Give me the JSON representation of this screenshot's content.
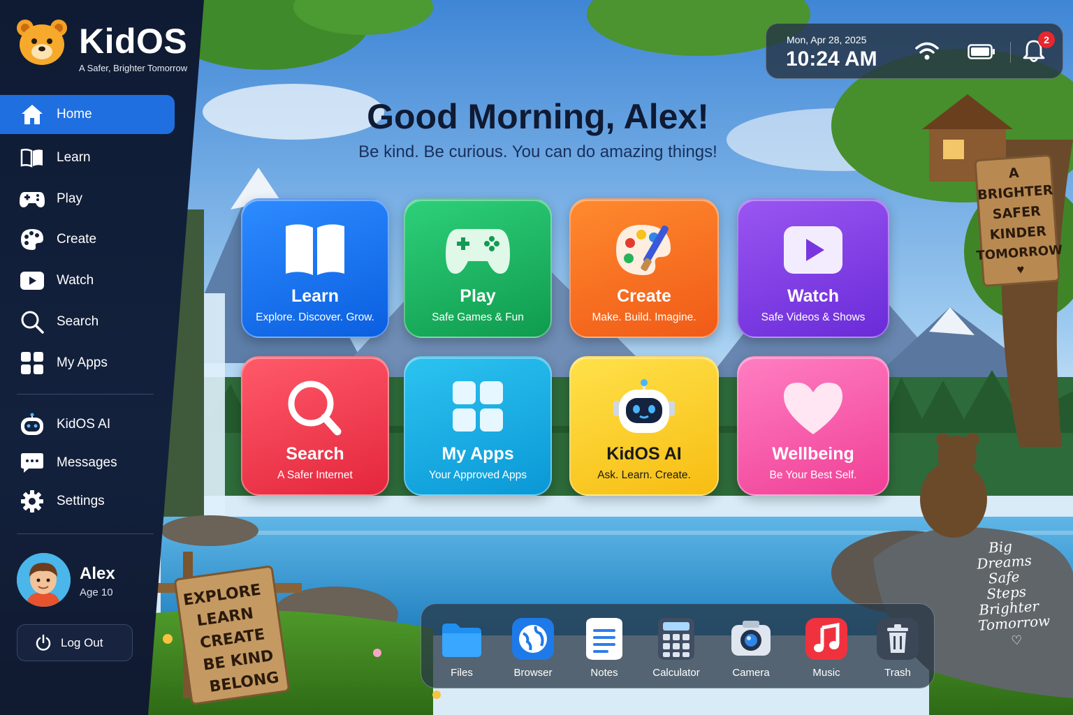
{
  "brand": {
    "name": "KidOS",
    "tagline": "A Safer, Brighter Tomorrow"
  },
  "sidebar": {
    "items": [
      {
        "label": "Home",
        "icon": "home-icon",
        "active": true
      },
      {
        "label": "Learn",
        "icon": "book-icon"
      },
      {
        "label": "Play",
        "icon": "gamepad-icon"
      },
      {
        "label": "Create",
        "icon": "palette-icon"
      },
      {
        "label": "Watch",
        "icon": "play-icon"
      },
      {
        "label": "Search",
        "icon": "search-icon"
      },
      {
        "label": "My Apps",
        "icon": "apps-grid-icon"
      }
    ],
    "secondary": [
      {
        "label": "KidOS AI",
        "icon": "robot-icon"
      },
      {
        "label": "Messages",
        "icon": "chat-icon"
      },
      {
        "label": "Settings",
        "icon": "gear-icon"
      }
    ],
    "profile": {
      "name": "Alex",
      "age": "Age 10"
    },
    "logout_label": "Log Out"
  },
  "status": {
    "date": "Mon, Apr 28, 2025",
    "time": "10:24 AM",
    "notifications": "2"
  },
  "main": {
    "greeting": "Good Morning, Alex!",
    "subline": "Be kind. Be curious. You can do amazing things!",
    "tiles": [
      {
        "label": "Learn",
        "sub": "Explore. Discover. Grow."
      },
      {
        "label": "Play",
        "sub": "Safe Games & Fun"
      },
      {
        "label": "Create",
        "sub": "Make. Build. Imagine."
      },
      {
        "label": "Watch",
        "sub": "Safe Videos & Shows"
      },
      {
        "label": "Search",
        "sub": "A Safer Internet"
      },
      {
        "label": "My Apps",
        "sub": "Your Approved Apps"
      },
      {
        "label": "KidOS AI",
        "sub": "Ask. Learn. Create."
      },
      {
        "label": "Wellbeing",
        "sub": "Be Your Best Self."
      }
    ]
  },
  "dock": [
    {
      "label": "Files",
      "icon": "folder-icon"
    },
    {
      "label": "Browser",
      "icon": "globe-icon"
    },
    {
      "label": "Notes",
      "icon": "notes-icon"
    },
    {
      "label": "Calculator",
      "icon": "calculator-icon"
    },
    {
      "label": "Camera",
      "icon": "camera-icon"
    },
    {
      "label": "Music",
      "icon": "music-icon"
    },
    {
      "label": "Trash",
      "icon": "trash-icon"
    }
  ],
  "signs": {
    "left": [
      "EXPLORE",
      "LEARN",
      "CREATE",
      "BE KIND",
      "BELONG"
    ],
    "right": [
      "A",
      "BRIGHTER",
      "SAFER",
      "KINDER",
      "TOMORROW"
    ],
    "rock": [
      "Big",
      "Dreams",
      "Safe",
      "Steps",
      "Brighter",
      "Tomorrow"
    ]
  },
  "colors": {
    "accent": "#1f6fe0",
    "sidebar_bg": "#13213d",
    "badge": "#e8262e"
  }
}
